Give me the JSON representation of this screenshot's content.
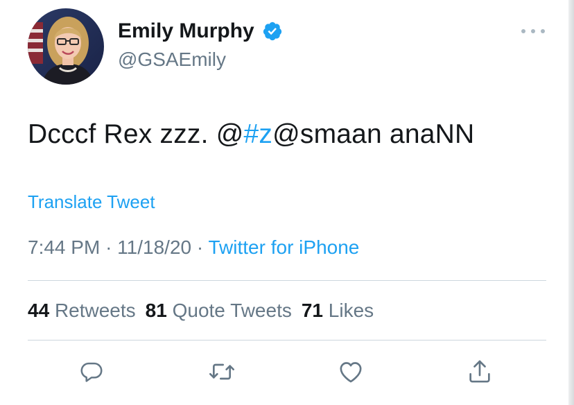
{
  "author": {
    "name": "Emily Murphy",
    "handle": "@GSAEmily",
    "verified": true
  },
  "tweet": {
    "text_before": "Dcccf Rex zzz.  @",
    "hashtag": "#z",
    "text_after": "@smaan anaNN",
    "translate_label": "Translate Tweet",
    "time": "7:44 PM",
    "date": "11/18/20",
    "separator": "·",
    "source": "Twitter for iPhone"
  },
  "stats": {
    "retweets_count": "44",
    "retweets_label": "Retweets",
    "quote_tweets_count": "81",
    "quote_tweets_label": "Quote Tweets",
    "likes_count": "71",
    "likes_label": "Likes"
  },
  "icons": {
    "reply": "reply-icon",
    "retweet": "retweet-icon",
    "like": "heart-icon",
    "share": "share-icon",
    "more": "more-icon",
    "verified": "verified-badge-icon"
  },
  "colors": {
    "accent": "#1da1f2",
    "secondary_text": "#657786",
    "primary_text": "#14171a",
    "divider": "#ccd6dd",
    "icon": "#657786"
  }
}
